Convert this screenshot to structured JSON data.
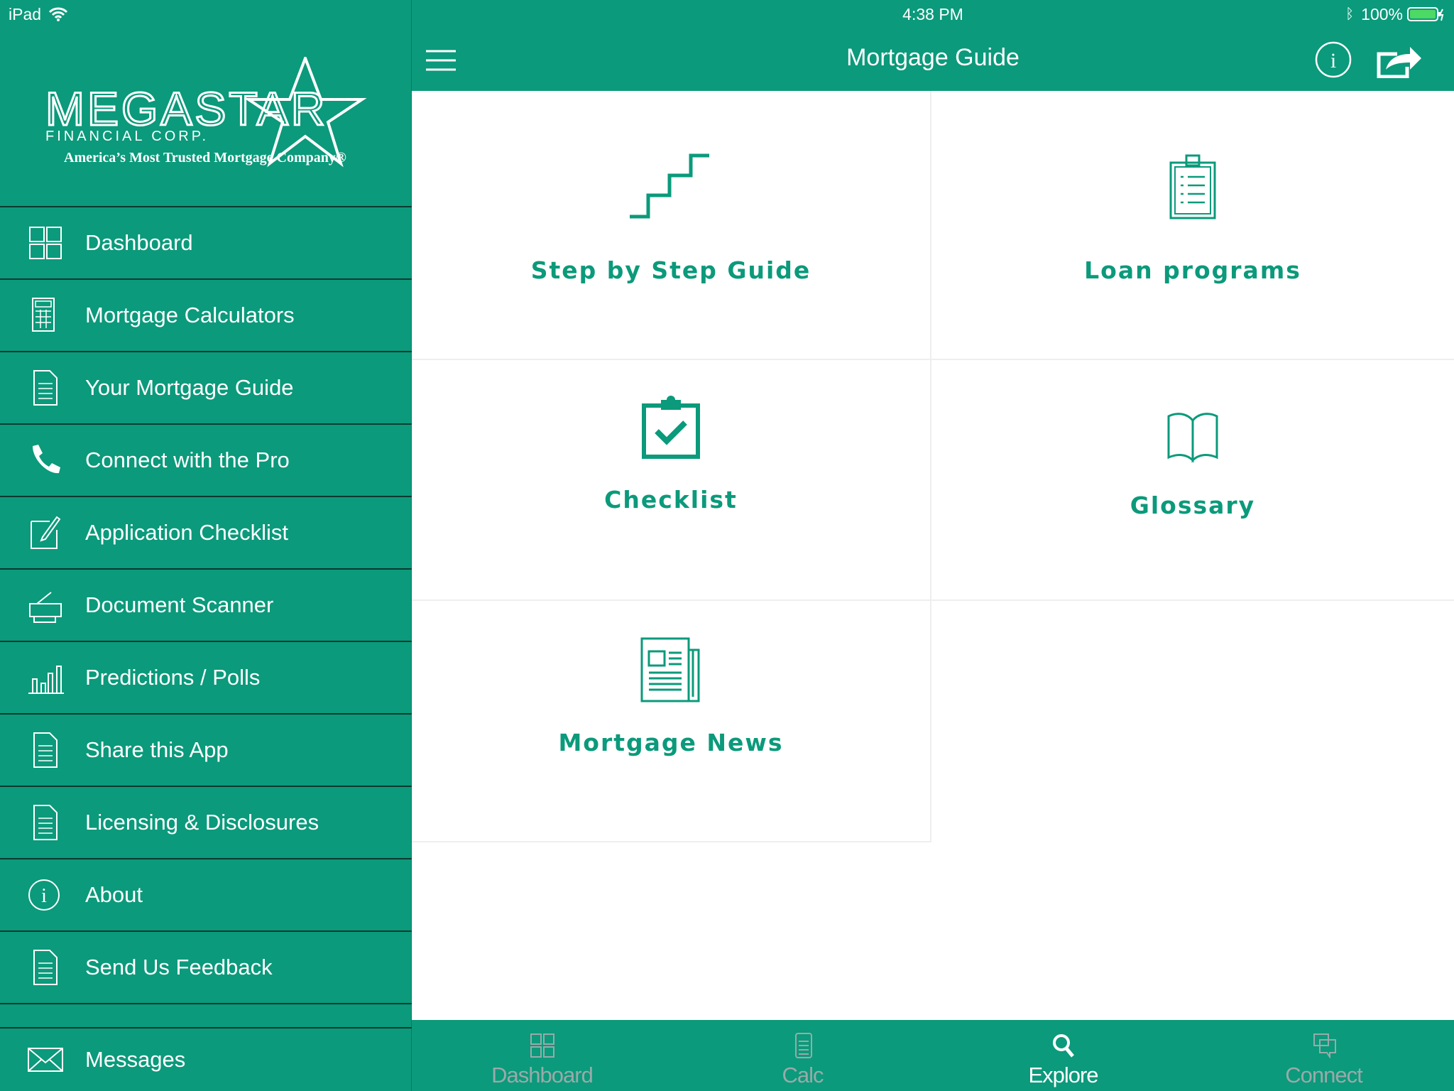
{
  "status_bar": {
    "device": "iPad",
    "time": "4:38 PM",
    "battery": "100%"
  },
  "logo": {
    "name": "MEGASTAR",
    "sub": "FINANCIAL CORP.",
    "tagline": "America’s Most Trusted Mortgage Company®"
  },
  "sidebar": {
    "items": [
      {
        "label": "Dashboard",
        "icon": "grid-icon"
      },
      {
        "label": "Mortgage Calculators",
        "icon": "calculator-icon"
      },
      {
        "label": "Your Mortgage Guide",
        "icon": "document-icon"
      },
      {
        "label": "Connect with the Pro",
        "icon": "phone-icon"
      },
      {
        "label": "Application Checklist",
        "icon": "edit-icon"
      },
      {
        "label": "Document Scanner",
        "icon": "scanner-icon"
      },
      {
        "label": "Predictions / Polls",
        "icon": "bar-chart-icon"
      },
      {
        "label": "Share this App",
        "icon": "document-icon"
      },
      {
        "label": "Licensing & Disclosures",
        "icon": "document-icon"
      },
      {
        "label": "About",
        "icon": "info-icon"
      },
      {
        "label": "Send Us Feedback",
        "icon": "document-icon"
      }
    ],
    "messages": "Messages"
  },
  "header": {
    "title": "Mortgage Guide"
  },
  "tiles": [
    {
      "label": "Step by Step Guide",
      "icon": "stairs-icon"
    },
    {
      "label": "Loan programs",
      "icon": "clipboard-list-icon"
    },
    {
      "label": "Checklist",
      "icon": "clipboard-check-icon"
    },
    {
      "label": "Glossary",
      "icon": "book-icon"
    },
    {
      "label": "Mortgage News",
      "icon": "newspaper-icon"
    }
  ],
  "tabbar": {
    "items": [
      {
        "label": "Dashboard"
      },
      {
        "label": "Calc"
      },
      {
        "label": "Explore",
        "active": true
      },
      {
        "label": "Connect"
      }
    ]
  },
  "colors": {
    "brand": "#0b9a7b"
  }
}
